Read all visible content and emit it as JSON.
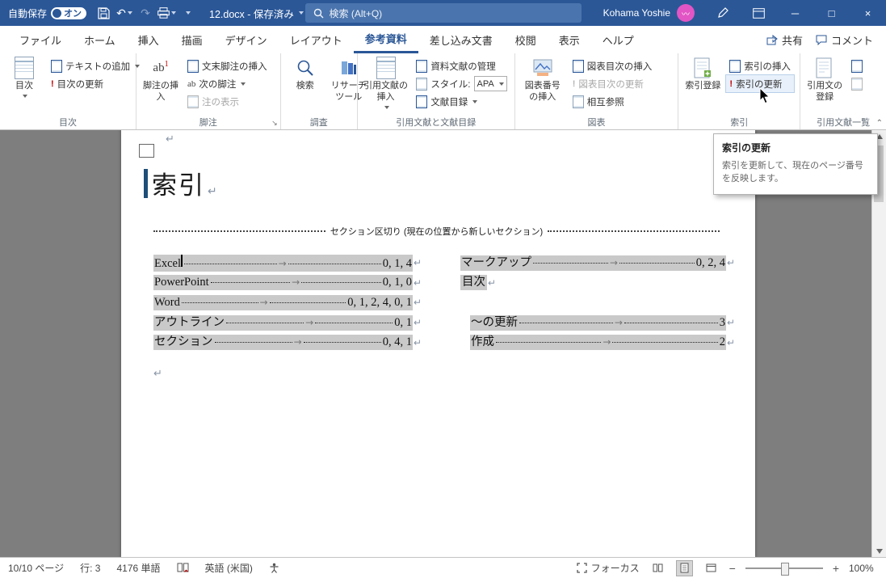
{
  "titlebar": {
    "autosave_label": "自動保存",
    "autosave_state": "オン",
    "filename": "12.docx - 保存済み",
    "search_placeholder": "検索 (Alt+Q)",
    "user_name": "Kohama Yoshie"
  },
  "tabs": {
    "file": "ファイル",
    "items": [
      "ホーム",
      "挿入",
      "描画",
      "デザイン",
      "レイアウト",
      "参考資料",
      "差し込み文書",
      "校閲",
      "表示",
      "ヘルプ"
    ],
    "share": "共有",
    "comments": "コメント"
  },
  "ribbon": {
    "toc_group": {
      "label": "目次",
      "toc": "目次",
      "add_text": "テキストの追加",
      "update_toc": "目次の更新"
    },
    "footnote_group": {
      "label": "脚注",
      "insert_footnote": "脚注の挿入",
      "insert_endnote": "文末脚注の挿入",
      "next_footnote": "次の脚注",
      "show_notes": "注の表示",
      "ab_glyph": "ab"
    },
    "research_group": {
      "label": "調査",
      "search": "検索",
      "research_tools": "リサーチ ツール"
    },
    "citations_group": {
      "label": "引用文献と文献目録",
      "insert_citation": "引用文献の挿入",
      "manage_sources": "資料文献の管理",
      "style_label": "スタイル:",
      "style_value": "APA",
      "bibliography": "文献目録"
    },
    "captions_group": {
      "label": "図表",
      "insert_caption": "図表番号の挿入",
      "insert_tof": "図表目次の挿入",
      "update_tof": "図表目次の更新",
      "cross_ref": "相互参照"
    },
    "index_group": {
      "label": "索引",
      "mark_entry": "索引登録",
      "insert_index": "索引の挿入",
      "update_index": "索引の更新"
    },
    "toa_group": {
      "label": "引用文献一覧",
      "mark_citation": "引用文の登録"
    }
  },
  "tooltip": {
    "title": "索引の更新",
    "description": "索引を更新して、現在のページ番号を反映します。"
  },
  "document": {
    "heading": "索引",
    "section_break": "セクション区切り (現在の位置から新しいセクション)",
    "index_left": [
      {
        "term": "Excel",
        "pages": "0, 1, 4"
      },
      {
        "term": "PowerPoint",
        "pages": "0, 1, 0"
      },
      {
        "term": "Word",
        "pages": "0, 1, 2, 4, 0, 1"
      },
      {
        "term": "アウトライン",
        "pages": "0, 1"
      },
      {
        "term": "セクション",
        "pages": "0, 4, 1"
      }
    ],
    "index_right": [
      {
        "term": "マークアップ",
        "pages": "0, 2, 4"
      },
      {
        "term": "目次",
        "pages": ""
      },
      {
        "term": "～の更新",
        "pages": "3"
      },
      {
        "term": "作成",
        "pages": "2"
      }
    ]
  },
  "statusbar": {
    "page": "10/10 ページ",
    "line": "行: 3",
    "words": "4176 単語",
    "language": "英語 (米国)",
    "focus": "フォーカス",
    "zoom": "100%"
  }
}
